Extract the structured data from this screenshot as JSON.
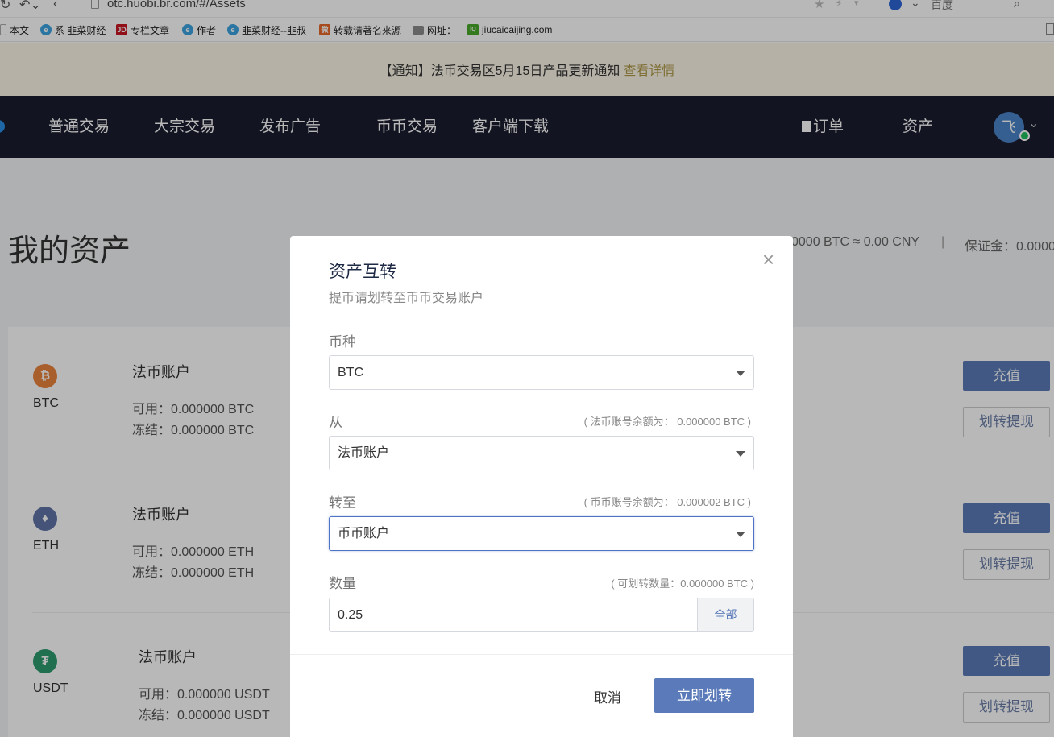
{
  "browser": {
    "url": "otc.huobi.br.com/#/Assets",
    "search_engine_label": "百度",
    "bookmarks": [
      {
        "label": "本文",
        "icon": "page-icon"
      },
      {
        "label": "系 韭菜财经",
        "icon": "ie-icon"
      },
      {
        "label": "专栏文章",
        "icon": "jd-icon"
      },
      {
        "label": "作者",
        "icon": "ie-icon"
      },
      {
        "label": "韭菜财经--韭叔",
        "icon": "ie-icon"
      },
      {
        "label": "转载请著名来源",
        "icon": "weibo-icon"
      },
      {
        "label": "网址：",
        "icon": "folder-icon"
      },
      {
        "label": "jiucaicaijing.com",
        "icon": "iqiyi-icon"
      }
    ]
  },
  "notice": {
    "text": "【通知】法币交易区5月15日产品更新通知",
    "link": "查看详情"
  },
  "nav": {
    "items": [
      "普通交易",
      "大宗交易",
      "发布广告",
      "币币交易",
      "客户端下载"
    ],
    "orders": "订单",
    "assets": "资产",
    "avatar_char": "飞"
  },
  "page": {
    "title": "我的资产",
    "summary_total": "0000 BTC ≈ 0.00 CNY",
    "summary_divider": "|",
    "summary_margin": "保证金：0.0000",
    "assets": [
      {
        "coin": "BTC",
        "account": "法币账户",
        "available": "可用：0.000000 BTC",
        "frozen": "冻结：0.000000 BTC",
        "color": "#e9843e"
      },
      {
        "coin": "ETH",
        "account": "法币账户",
        "available": "可用：0.000000 ETH",
        "frozen": "冻结：0.000000 ETH",
        "color": "#6274a8"
      },
      {
        "coin": "USDT",
        "account": "法币账户",
        "available": "可用：0.000000 USDT",
        "frozen": "冻结：0.000000 USDT",
        "color": "#2d9b6f"
      }
    ],
    "deposit_label": "充值",
    "transfer_label": "划转提现"
  },
  "modal": {
    "title": "资产互转",
    "subtitle": "提币请划转至币币交易账户",
    "currency_label": "币种",
    "currency_value": "BTC",
    "from_label": "从",
    "from_hint": "( 法币账号余额为： 0.000000 BTC )",
    "from_value": "法币账户",
    "to_label": "转至",
    "to_hint": "( 币币账号余额为： 0.000002 BTC )",
    "to_value": "币币账户",
    "amount_label": "数量",
    "amount_hint": "( 可划转数量：0.000000 BTC )",
    "amount_value": "0.25",
    "all_button": "全部",
    "cancel_button": "取消",
    "confirm_button": "立即划转"
  },
  "colors": {
    "nav_bg": "#1a1d2e",
    "accent": "#5b7ab9",
    "notice_bg": "#fbf6e6",
    "notice_link": "#ad9745"
  }
}
